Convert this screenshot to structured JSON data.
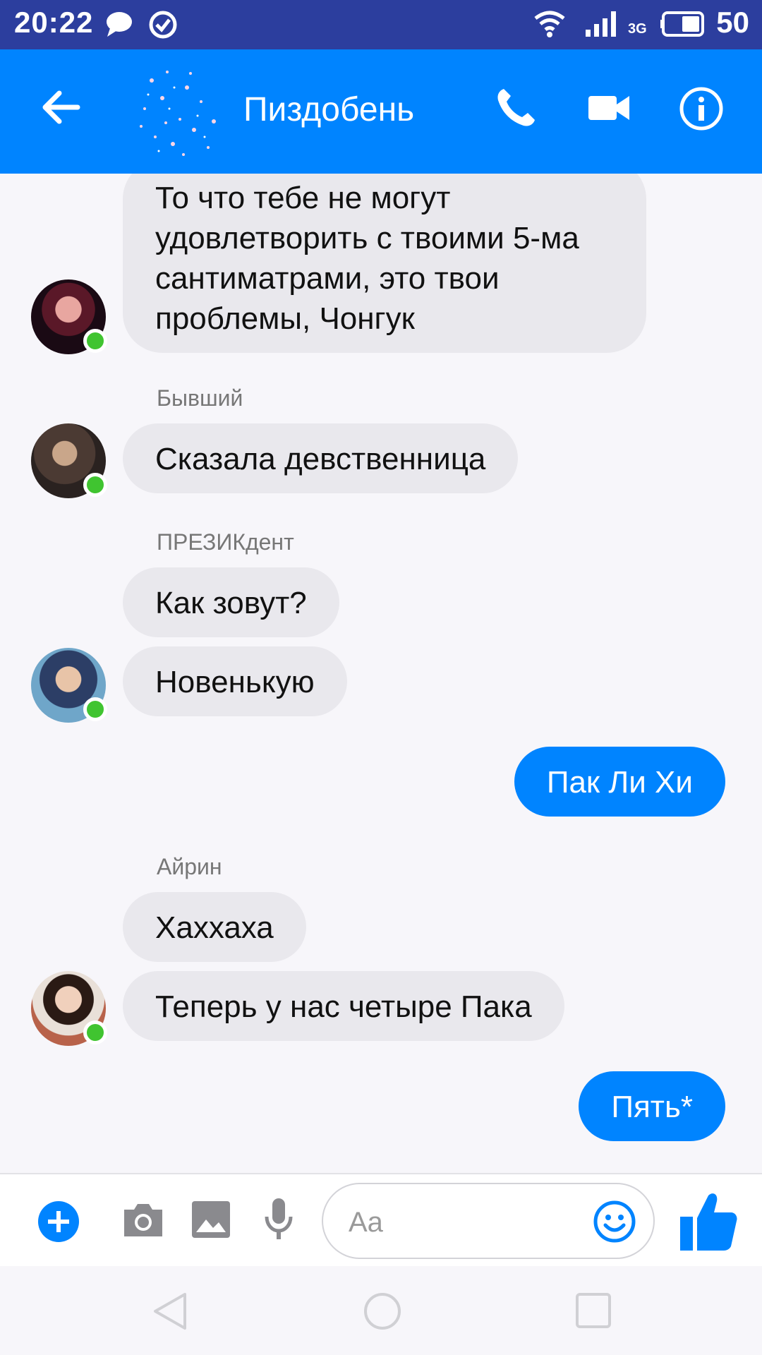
{
  "status_bar": {
    "time": "20:22",
    "network": "3G",
    "battery": "50",
    "icons": [
      "chat-bubble-icon",
      "check-circle-icon",
      "wifi-icon",
      "signal-icon",
      "battery-icon"
    ]
  },
  "header": {
    "title": "Пиздобень",
    "icons": [
      "back-arrow-icon",
      "phone-icon",
      "video-camera-icon",
      "info-icon"
    ],
    "accent_color": "#0084ff"
  },
  "messages": [
    {
      "text": "То что тебе не могут удовлетворить с твоими 5-ма сантиматрами, это твои проблемы, Чонгук",
      "direction": "incoming"
    },
    {
      "sender": "Бывший",
      "text": "Сказала девственница",
      "direction": "incoming"
    },
    {
      "sender": "ПРЕЗИКдент",
      "text": "Как зовут?",
      "direction": "incoming"
    },
    {
      "text": "Новенькую",
      "direction": "incoming"
    },
    {
      "text": "Пак Ли Хи",
      "direction": "outgoing"
    },
    {
      "sender": "Айрин",
      "text": "Хаххаха",
      "direction": "incoming"
    },
    {
      "text": "Теперь у нас четыре Пака",
      "direction": "incoming"
    },
    {
      "text": "Пять*",
      "direction": "outgoing"
    }
  ],
  "composer": {
    "placeholder": "Aa",
    "icons": [
      "plus-icon",
      "camera-icon",
      "image-icon",
      "microphone-icon",
      "emoji-icon",
      "thumbs-up-icon"
    ]
  },
  "nav_bar": {
    "icons": [
      "nav-back-icon",
      "nav-home-icon",
      "nav-recents-icon"
    ]
  },
  "colors": {
    "status_bar": "#2c3e9e",
    "header": "#0084ff",
    "incoming_bubble": "#e9e8ed",
    "outgoing_bubble": "#0084ff",
    "online_dot": "#40c430"
  }
}
